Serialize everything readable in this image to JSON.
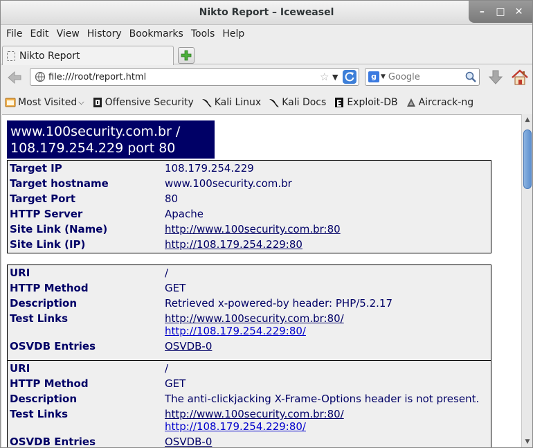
{
  "window": {
    "title": "Nikto Report – Iceweasel",
    "minimize": "–",
    "maximize": "□",
    "close": "✕"
  },
  "menu": [
    "File",
    "Edit",
    "View",
    "History",
    "Bookmarks",
    "Tools",
    "Help"
  ],
  "tab": {
    "label": "Nikto Report"
  },
  "navbar": {
    "url": "file:///root/report.html",
    "search_placeholder": "Google"
  },
  "bookmarks": [
    {
      "label": "Most Visited",
      "icon": "most-visited-icon",
      "dropdown": "⌵"
    },
    {
      "label": "Offensive Security",
      "icon": "offsec-icon"
    },
    {
      "label": "Kali Linux",
      "icon": "kali-icon"
    },
    {
      "label": "Kali Docs",
      "icon": "kali-icon"
    },
    {
      "label": "Exploit-DB",
      "icon": "exploitdb-icon"
    },
    {
      "label": "Aircrack-ng",
      "icon": "aircrack-icon"
    }
  ],
  "report": {
    "heading_line1": "www.100security.com.br /",
    "heading_line2": "108.179.254.229 port 80",
    "target": {
      "ip_label": "Target IP",
      "ip": "108.179.254.229",
      "hostname_label": "Target hostname",
      "hostname": "www.100security.com.br",
      "port_label": "Target Port",
      "port": "80",
      "server_label": "HTTP Server",
      "server": "Apache",
      "link_name_label": "Site Link (Name)",
      "link_name": "http://www.100security.com.br:80",
      "link_ip_label": "Site Link (IP)",
      "link_ip": "http://108.179.254.229:80"
    },
    "findings": [
      {
        "uri_label": "URI",
        "uri": "/",
        "method_label": "HTTP Method",
        "method": "GET",
        "desc_label": "Description",
        "desc": "Retrieved x-powered-by header: PHP/5.2.17",
        "links_label": "Test Links",
        "link1": "http://www.100security.com.br:80/",
        "link2": "http://108.179.254.229:80/",
        "osvdb_label": "OSVDB Entries",
        "osvdb": "OSVDB-0"
      },
      {
        "uri_label": "URI",
        "uri": "/",
        "method_label": "HTTP Method",
        "method": "GET",
        "desc_label": "Description",
        "desc": "The anti-clickjacking X-Frame-Options header is not present.",
        "links_label": "Test Links",
        "link1": "http://www.100security.com.br:80/",
        "link2": "http://108.179.254.229:80/",
        "osvdb_label": "OSVDB Entries",
        "osvdb": "OSVDB-0"
      }
    ]
  },
  "colors": {
    "heading_bg": "#000066",
    "label": "#000066",
    "link": "#0000cc",
    "visited_link": "#551a8b",
    "box_bg": "#efefef"
  }
}
